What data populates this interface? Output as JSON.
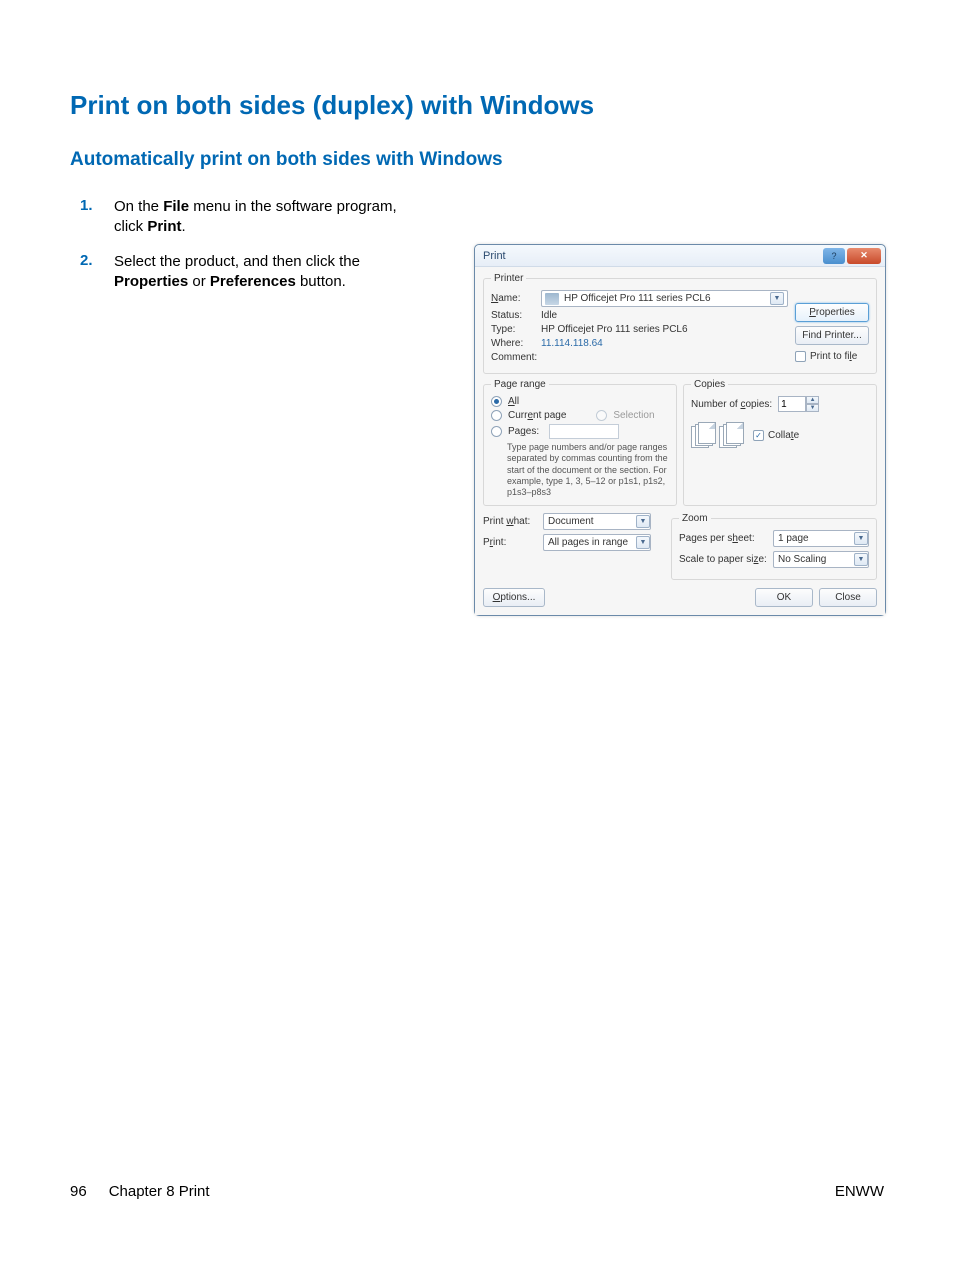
{
  "page": {
    "title": "Print on both sides (duplex) with Windows",
    "subtitle": "Automatically print on both sides with Windows",
    "steps": {
      "num1": "1.",
      "body1_pre": "On the ",
      "body1_b1": "File",
      "body1_mid": " menu in the software program, click ",
      "body1_b2": "Print",
      "body1_post": ".",
      "num2": "2.",
      "body2_pre": "Select the product, and then click the ",
      "body2_b1": "Properties",
      "body2_mid": " or ",
      "body2_b2": "Preferences",
      "body2_post": " button."
    }
  },
  "dialog": {
    "title": "Print",
    "printer": {
      "legend": "Printer",
      "name_lbl": "Name:",
      "name_val": "HP Officejet Pro 111 series PCL6",
      "status_lbl": "Status:",
      "status_val": "Idle",
      "type_lbl": "Type:",
      "type_val": "HP Officejet Pro 111 series PCL6",
      "where_lbl": "Where:",
      "where_val": "11.114.118.64",
      "comment_lbl": "Comment:",
      "btn_properties": "Properties",
      "btn_find": "Find Printer...",
      "chk_printfile": "Print to file"
    },
    "pagerange": {
      "legend": "Page range",
      "all": "All",
      "current": "Current page",
      "selection": "Selection",
      "pages": "Pages:",
      "hint": "Type page numbers and/or page ranges separated by commas counting from the start of the document or the section. For example, type 1, 3, 5–12 or p1s1, p1s2, p1s3–p8s3"
    },
    "copies": {
      "legend": "Copies",
      "num_lbl": "Number of copies:",
      "num_val": "1",
      "collate": "Collate"
    },
    "bottom": {
      "printwhat_lbl": "Print what:",
      "printwhat_val": "Document",
      "print_lbl": "Print:",
      "print_val": "All pages in range",
      "zoom_legend": "Zoom",
      "pps_lbl": "Pages per sheet:",
      "pps_val": "1 page",
      "scale_lbl": "Scale to paper size:",
      "scale_val": "No Scaling"
    },
    "footer": {
      "options": "Options...",
      "ok": "OK",
      "close": "Close"
    }
  },
  "footer": {
    "page_num": "96",
    "chapter": "Chapter 8   Print",
    "brand": "ENWW"
  }
}
